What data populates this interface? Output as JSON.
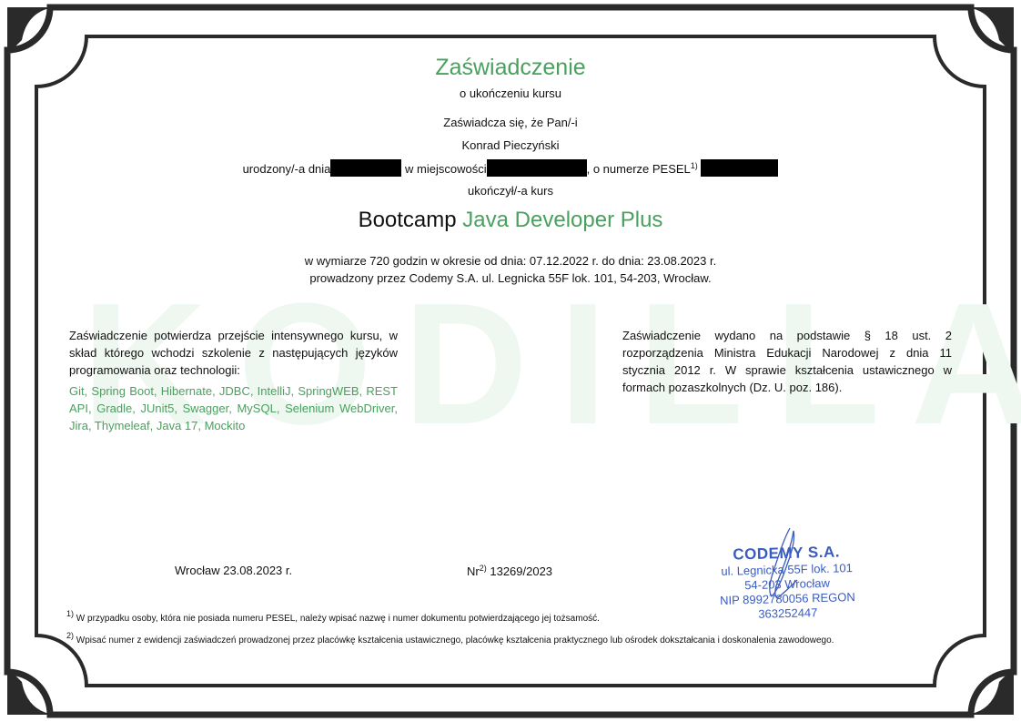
{
  "header": {
    "title": "Zaświadczenie",
    "subtitle": "o ukończeniu kursu"
  },
  "body": {
    "certifies": "Zaświadcza się, że Pan/-i",
    "person_name": "Konrad Pieczyński",
    "born_on": "urodzony/-a dnia",
    "in_place": "w miejscowości",
    "pesel_label": ", o numerze PESEL",
    "pesel_sup": "1)",
    "completed": "ukończył/-a kurs",
    "course_prefix": "Bootcamp",
    "course_name": "Java Developer Plus",
    "duration_line": "w wymiarze 720 godzin w okresie od dnia: 07.12.2022 r. do dnia: 23.08.2023 r.",
    "provider_line": "prowadzony przez Codemy S.A. ul. Legnicka 55F lok. 101, 54-203, Wrocław."
  },
  "watermark": "KODILLA",
  "left_paragraph": {
    "intro": "Zaświadczenie potwierdza przejście intensywnego kursu, w skład którego wchodzi szkolenie z następujących języków programowania oraz technologii:",
    "technologies": "Git, Spring Boot, Hibernate, JDBC, IntelliJ, SpringWEB, REST API, Gradle, JUnit5, Swagger, MySQL, Selenium WebDriver, Jira, Thymeleaf, Java 17, Mockito"
  },
  "right_paragraph": {
    "text": "Zaświadczenie wydano na podstawie § 18 ust. 2 rozporządzenia Ministra Edukacji Narodowej z dnia 11 stycznia 2012 r. W sprawie kształcenia ustawicznego w formach pozaszkolnych (Dz. U. poz. 186)."
  },
  "bottom": {
    "place_date": "Wrocław 23.08.2023 r.",
    "number_label": "Nr",
    "number_sup": "2)",
    "number_value": "13269/2023"
  },
  "stamp": {
    "company": "CODEMY S.A.",
    "street": "ul. Legnicka 55F lok. 101",
    "city": "54-203 Wrocław",
    "ids": "NIP 8992780056 REGON 363252447"
  },
  "footnotes": [
    {
      "mark": "1)",
      "text": "W przypadku osoby, która nie posiada numeru PESEL, należy wpisać nazwę i numer dokumentu potwierdzającego jej tożsamość."
    },
    {
      "mark": "2)",
      "text": "Wpisać numer z ewidencji zaświadczeń prowadzonej przez placówkę kształcenia ustawicznego, placówkę kształcenia praktycznego lub ośrodek dokształcania i doskonalenia zawodowego."
    }
  ],
  "colors": {
    "accent_green": "#4aa05e",
    "stamp_blue": "#3a5cc0",
    "frame": "#2a2a2a"
  }
}
